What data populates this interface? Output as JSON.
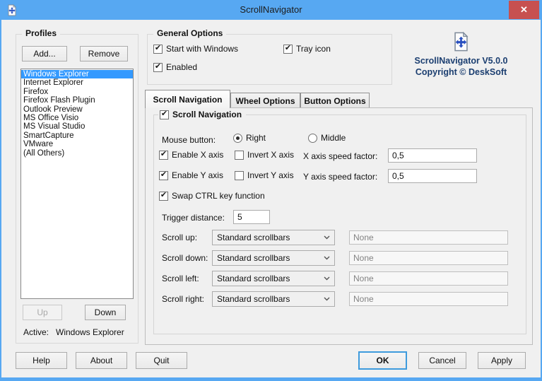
{
  "window": {
    "title": "ScrollNavigator"
  },
  "icons": {
    "check": "✔",
    "close": "✕"
  },
  "colors": {
    "titlebar": "#57A8F2",
    "close_button": "#C75050",
    "list_selection": "#3399FF",
    "brand_text": "#1B3E70",
    "ok_border": "#3E9BDD"
  },
  "profiles": {
    "group_label": "Profiles",
    "add_button": "Add...",
    "remove_button": "Remove",
    "items": [
      "Windows Explorer",
      "Internet Explorer",
      "Firefox",
      "Firefox Flash Plugin",
      "Outlook Preview",
      "MS Office Visio",
      "MS Visual Studio",
      "SmartCapture",
      "VMware",
      "(All Others)"
    ],
    "selected_item": "Windows Explorer",
    "up_button": "Up",
    "down_button": "Down",
    "active_label": "Active:",
    "active_value": "Windows Explorer"
  },
  "general_options": {
    "group_label": "General Options",
    "start_with_windows": "Start with Windows",
    "tray_icon": "Tray icon",
    "enabled": "Enabled"
  },
  "branding": {
    "version": "ScrollNavigator V5.0.0",
    "copyright": "Copyright © DeskSoft"
  },
  "tabs": [
    "Scroll Navigation",
    "Wheel Options",
    "Button Options"
  ],
  "scroll_navigation": {
    "header": "Scroll Navigation",
    "mouse_button_label": "Mouse button:",
    "radio_right": "Right",
    "radio_middle": "Middle",
    "enable_x": "Enable X axis",
    "invert_x": "Invert X axis",
    "x_speed_label": "X axis speed factor:",
    "x_speed_value": "0,5",
    "enable_y": "Enable Y axis",
    "invert_y": "Invert Y axis",
    "y_speed_label": "Y axis speed factor:",
    "y_speed_value": "0,5",
    "swap_ctrl": "Swap CTRL key function",
    "trigger_label": "Trigger distance:",
    "trigger_value": "5",
    "rows": [
      {
        "label": "Scroll up:",
        "dropdown": "Standard scrollbars",
        "target": "None"
      },
      {
        "label": "Scroll down:",
        "dropdown": "Standard scrollbars",
        "target": "None"
      },
      {
        "label": "Scroll left:",
        "dropdown": "Standard scrollbars",
        "target": "None"
      },
      {
        "label": "Scroll right:",
        "dropdown": "Standard scrollbars",
        "target": "None"
      }
    ]
  },
  "footer": {
    "help": "Help",
    "about": "About",
    "quit": "Quit",
    "ok": "OK",
    "cancel": "Cancel",
    "apply": "Apply"
  }
}
